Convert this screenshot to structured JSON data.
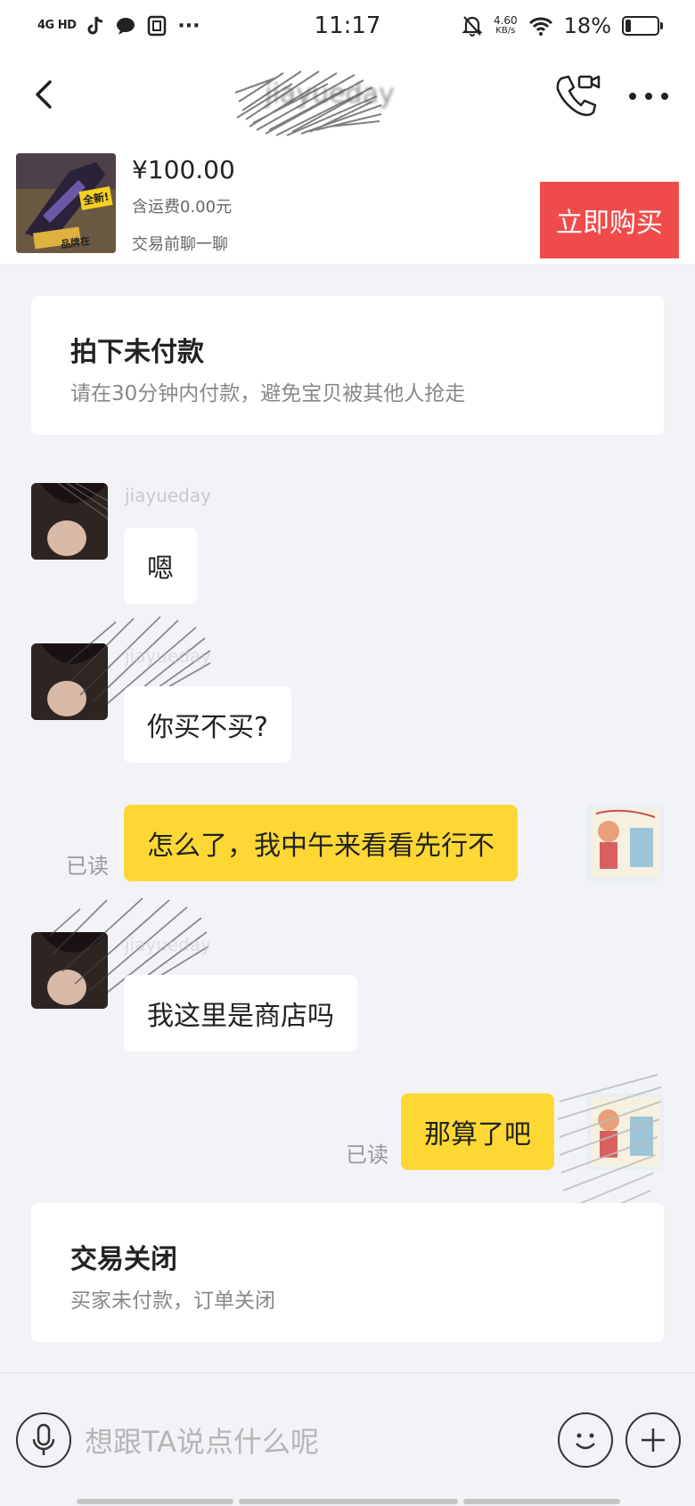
{
  "status_bar": {
    "network": "4G HD",
    "time": "11:17",
    "speed_value": "4.60",
    "speed_unit": "KB/s",
    "battery_percent": "18%",
    "battery_level": 0.18
  },
  "nav": {
    "title": "jiayueday"
  },
  "product": {
    "price": "¥100.00",
    "shipping": "含运费0.00元",
    "hint": "交易前聊一聊",
    "badge_top": "全新!",
    "badge_bottom": "品牌在",
    "buy_label": "立即购买"
  },
  "notice_unpaid": {
    "title": "拍下未付款",
    "subtitle": "请在30分钟内付款，避免宝贝被其他人抢走"
  },
  "messages": [
    {
      "side": "left",
      "sender": "jiayueday",
      "text": "嗯"
    },
    {
      "side": "left",
      "sender": "jiayueday",
      "text": "你买不买?"
    },
    {
      "side": "right",
      "status": "已读",
      "text": "怎么了，我中午来看看先行不"
    },
    {
      "side": "left",
      "sender": "jiayueday",
      "text": "我这里是商店吗"
    },
    {
      "side": "right",
      "status": "已读",
      "text": "那算了吧"
    }
  ],
  "notice_closed": {
    "title": "交易关闭",
    "subtitle": "买家未付款，订单关闭"
  },
  "input": {
    "placeholder": "想跟TA说点什么呢"
  },
  "colors": {
    "accent_buy": "#f04b4b",
    "bubble_self": "#fdd835",
    "background": "#f2f3f7"
  }
}
